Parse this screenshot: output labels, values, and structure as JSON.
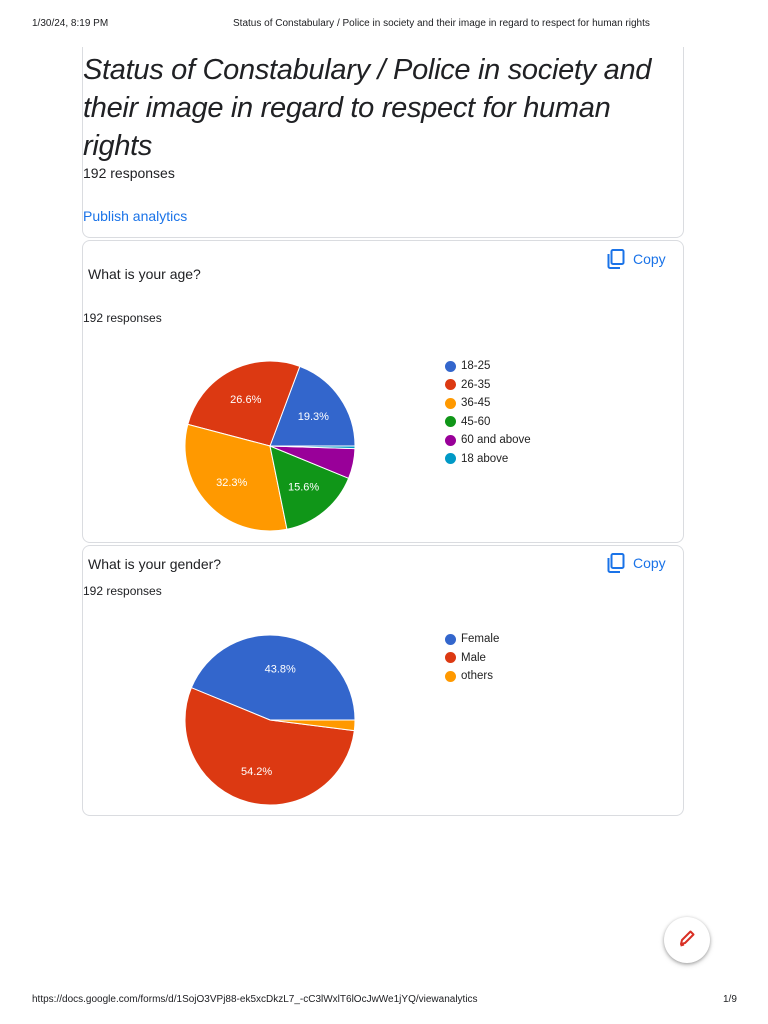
{
  "print_header": {
    "datetime": "1/30/24, 8:19 PM",
    "title": "Status of Constabulary / Police in society and their image in regard to respect for human rights"
  },
  "form": {
    "title": "Status of Constabulary / Police in society and their image in regard to respect for human rights",
    "responses": "192 responses",
    "publish_analytics": "Publish analytics"
  },
  "questions": [
    {
      "title": "What is your age?",
      "responses": "192 responses",
      "copy_label": "Copy",
      "copy_icon": "copy-icon"
    },
    {
      "title": "What is your gender?",
      "responses": "192 responses",
      "copy_label": "Copy",
      "copy_icon": "copy-icon"
    }
  ],
  "chart_data": [
    {
      "type": "pie",
      "title": "",
      "categories": [
        "18-25",
        "26-35",
        "36-45",
        "45-60",
        "60 and above",
        "18 above"
      ],
      "values": [
        19.3,
        26.6,
        32.3,
        15.6,
        5.7,
        0.5
      ],
      "labels": [
        "19.3%",
        "26.6%",
        "32.3%",
        "15.6%",
        "",
        ""
      ],
      "colors": [
        "#3366cc",
        "#dc3912",
        "#ff9900",
        "#109618",
        "#990099",
        "#0099c6"
      ],
      "legend": "right"
    },
    {
      "type": "pie",
      "title": "",
      "categories": [
        "Female",
        "Male",
        "others"
      ],
      "values": [
        43.8,
        54.2,
        2.0
      ],
      "labels": [
        "43.8%",
        "54.2%",
        ""
      ],
      "colors": [
        "#3366cc",
        "#dc3912",
        "#ff9900"
      ],
      "legend": "right"
    }
  ],
  "print_footer": {
    "url": "https://docs.google.com/forms/d/1SojO3VPj88-ek5xcDkzL7_-cC3lWxlT6lOcJwWe1jYQ/viewanalytics",
    "page": "1/9"
  },
  "fab": {
    "icon": "pencil-icon",
    "color": "#d93025"
  }
}
